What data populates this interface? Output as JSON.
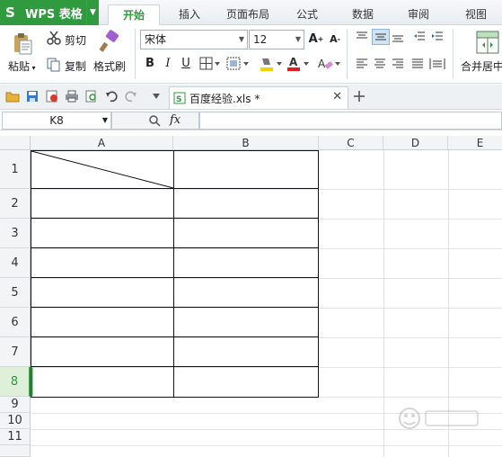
{
  "app": {
    "logo": "S",
    "title": "WPS 表格"
  },
  "tabs": [
    {
      "label": "开始",
      "active": true
    },
    {
      "label": "插入",
      "active": false
    },
    {
      "label": "页面布局",
      "active": false
    },
    {
      "label": "公式",
      "active": false
    },
    {
      "label": "数据",
      "active": false
    },
    {
      "label": "审阅",
      "active": false
    },
    {
      "label": "视图",
      "active": false
    }
  ],
  "ribbon": {
    "paste": "粘贴",
    "cut": "剪切",
    "copy": "复制",
    "format_painter": "格式刷",
    "font_name": "宋体",
    "font_size": "12",
    "bold": "B",
    "italic": "I",
    "underline": "U",
    "merge_center": "合并居中"
  },
  "document": {
    "tab_name": "百度经验.xls *"
  },
  "formula_bar": {
    "cell_ref": "K8",
    "fx": "fx"
  },
  "grid": {
    "columns": [
      "A",
      "B",
      "C",
      "D",
      "E"
    ],
    "rows": [
      "1",
      "2",
      "3",
      "4",
      "5",
      "6",
      "7",
      "8",
      "9",
      "10",
      "11"
    ],
    "selected_row": "8"
  },
  "colors": {
    "brand": "#2f9a3e",
    "ribbon_bg": "#ffffff",
    "header_bg": "#f2f4f6"
  }
}
